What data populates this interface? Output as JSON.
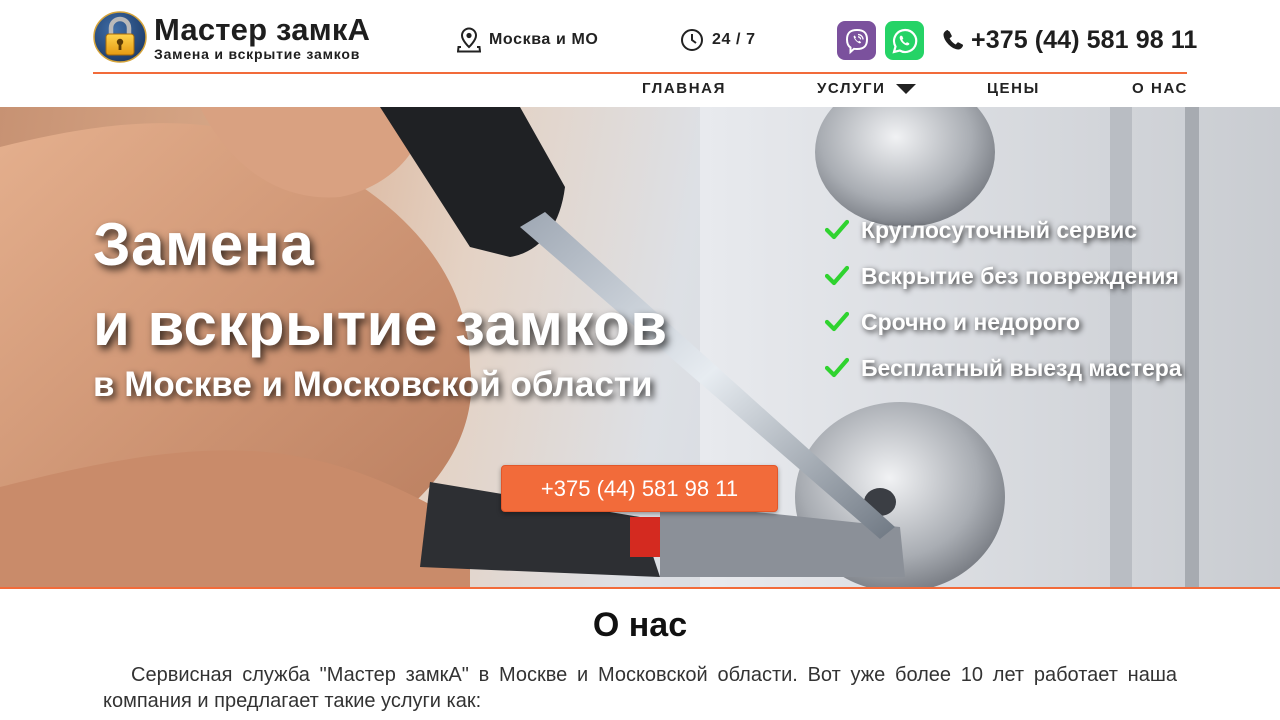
{
  "header": {
    "logo_title": "Мастер замкА",
    "logo_subtitle": "Замена и вскрытие замков",
    "location": "Москва и МО",
    "hours": "24 / 7",
    "phone": "+375 (44) 581 98 11",
    "accent_color": "#f26b3a"
  },
  "nav": {
    "items": [
      {
        "label": "ГЛАВНАЯ"
      },
      {
        "label": "УСЛУГИ",
        "has_dropdown": true
      },
      {
        "label": "ЦЕНЫ"
      },
      {
        "label": "О НАС"
      }
    ]
  },
  "hero": {
    "title_line1": "Замена",
    "title_line2": "и вскрытие замков",
    "subtitle": "в Москве и Московской области",
    "features": [
      "Круглосуточный сервис",
      "Вскрытие без повреждения",
      "Срочно и недорого",
      "Бесплатный выезд мастера"
    ],
    "cta_phone": "+375 (44) 581 98 11",
    "cta_color": "#f26b3a"
  },
  "about": {
    "title": "О нас",
    "text": "Сервисная служба \"Мастер замкА\" в Москве и Московской области. Вот уже более 10 лет работает наша компания и предлагает такие услуги как:"
  },
  "icons": {
    "logo": "padlock-icon",
    "location": "map-pin-icon",
    "hours": "clock-icon",
    "viber": "viber-icon",
    "whatsapp": "whatsapp-icon",
    "phone": "phone-icon",
    "feature": "checkmark-icon",
    "dropdown": "caret-down-icon"
  }
}
